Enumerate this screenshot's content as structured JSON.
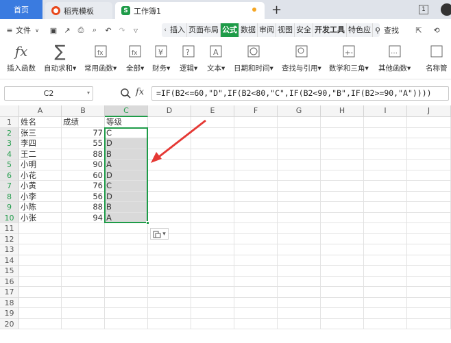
{
  "titlebar": {
    "home_tab": "首页",
    "tabs": [
      {
        "label": "稻壳模板"
      },
      {
        "label": "工作簿1"
      }
    ],
    "window_count": "1"
  },
  "menubar": {
    "file_label": "文件",
    "tabs": [
      "插入",
      "页面布局",
      "公式",
      "数据",
      "审阅",
      "视图",
      "安全",
      "开发工具",
      "特色应"
    ],
    "active_tab": "公式",
    "search_label": "查找"
  },
  "ribbon": {
    "buttons": [
      {
        "label": "插入函数"
      },
      {
        "label": "自动求和▾"
      },
      {
        "label": "常用函数▾"
      },
      {
        "label": "全部▾"
      },
      {
        "label": "财务▾"
      },
      {
        "label": "逻辑▾"
      },
      {
        "label": "文本▾"
      },
      {
        "label": "日期和时间▾"
      },
      {
        "label": "查找与引用▾"
      },
      {
        "label": "数学和三角▾"
      },
      {
        "label": "其他函数▾"
      },
      {
        "label": "名称管"
      }
    ]
  },
  "formula_bar": {
    "name_box": "C2",
    "fx_label": "fx",
    "formula": "=IF(B2<=60,\"D\",IF(B2<80,\"C\",IF(B2<90,\"B\",IF(B2>=90,\"A\"))))"
  },
  "sheet": {
    "columns": [
      "A",
      "B",
      "C",
      "D",
      "E",
      "F",
      "G",
      "H",
      "I",
      "J"
    ],
    "selected_column": "C",
    "rows": [
      {
        "n": "1",
        "a": "姓名",
        "b": "成绩",
        "c": "等级"
      },
      {
        "n": "2",
        "a": "张三",
        "b": "77",
        "c": "C"
      },
      {
        "n": "3",
        "a": "李四",
        "b": "55",
        "c": "D"
      },
      {
        "n": "4",
        "a": "王二",
        "b": "88",
        "c": "B"
      },
      {
        "n": "5",
        "a": "小明",
        "b": "90",
        "c": "A"
      },
      {
        "n": "6",
        "a": "小花",
        "b": "60",
        "c": "D"
      },
      {
        "n": "7",
        "a": "小黄",
        "b": "76",
        "c": "C"
      },
      {
        "n": "8",
        "a": "小李",
        "b": "56",
        "c": "D"
      },
      {
        "n": "9",
        "a": "小陈",
        "b": "88",
        "c": "B"
      },
      {
        "n": "10",
        "a": "小张",
        "b": "94",
        "c": "A"
      },
      {
        "n": "11"
      },
      {
        "n": "12"
      },
      {
        "n": "13"
      },
      {
        "n": "14"
      },
      {
        "n": "15"
      },
      {
        "n": "16"
      },
      {
        "n": "17"
      },
      {
        "n": "18"
      },
      {
        "n": "19"
      },
      {
        "n": "20"
      }
    ],
    "accent_color": "#1e9b48",
    "arrow_color": "#e53935"
  }
}
